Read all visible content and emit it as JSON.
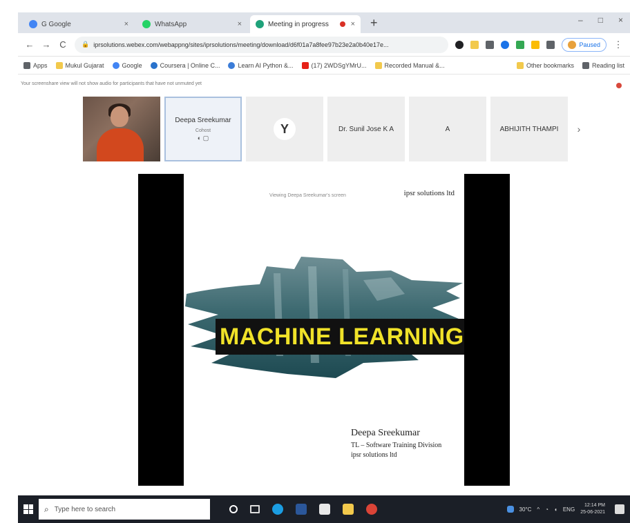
{
  "browser": {
    "tabs": [
      {
        "label": "G Google",
        "favicon_color": "#4285f4",
        "active": false
      },
      {
        "label": "WhatsApp",
        "favicon_color": "#25d366",
        "active": false
      },
      {
        "label": "Meeting in progress",
        "favicon_color": "#1fa27a",
        "active": true
      }
    ],
    "new_tab": "+",
    "tab_close": "×",
    "window_controls": {
      "minimize": "–",
      "maximize": "□",
      "close": "×"
    },
    "nav": {
      "back": "←",
      "forward": "→",
      "reload": "C"
    },
    "url": "iprsolutions.webex.com/webappng/sites/iprsolutions/meeting/download/d6f01a7a8fee97b23e2a0b40e17e...",
    "lock_icon": "🔒",
    "profile_label": "Paused",
    "bookmarks": [
      {
        "label": "Apps",
        "color": "#5f6368"
      },
      {
        "label": "Mukul Gujarat",
        "color": "#f2c94c"
      },
      {
        "label": "Google",
        "color": "#4285f4"
      },
      {
        "label": "Coursera | Online C...",
        "color": "#2a73cc"
      },
      {
        "label": "Learn AI Python &...",
        "color": "#3b7dd8"
      },
      {
        "label": "(17) 2WDSgYMrU...",
        "color": "#e62117"
      },
      {
        "label": "Recorded Manual &...",
        "color": "#f2c94c"
      }
    ],
    "bookmarks_right": [
      {
        "label": "Other bookmarks",
        "color": "#f2c94c"
      },
      {
        "label": "Reading list",
        "color": "#5f6368"
      }
    ]
  },
  "meeting": {
    "notice": "Your screenshare view will not show audio for participants that have not unmuted yet",
    "participants": [
      {
        "name": "",
        "type": "video"
      },
      {
        "name": "Deepa Sreekumar",
        "sub": "Cohost",
        "icons": "◐ ▢",
        "type": "selected"
      },
      {
        "name": "",
        "type": "logo",
        "logo_glyph": "Y"
      },
      {
        "name": "Dr. Sunil Jose K A",
        "type": "name"
      },
      {
        "name": "A",
        "type": "name"
      },
      {
        "name": "ABHIJITH THAMPI",
        "type": "name"
      }
    ],
    "strip_next": "›",
    "share": {
      "viewing_label": "Viewing Deepa Sreekumar's screen",
      "brand": "ipsr solutions ltd",
      "title": "MACHINE LEARNING",
      "presenter_name": "Deepa Sreekumar",
      "presenter_role": "TL – Software Training Division",
      "presenter_org": "ipsr solutions ltd"
    }
  },
  "taskbar": {
    "search_placeholder": "Type here to search",
    "tray_weather": "30°C",
    "tray_lang": "ENG",
    "time": "12:14 PM",
    "date": "25-06-2021"
  }
}
